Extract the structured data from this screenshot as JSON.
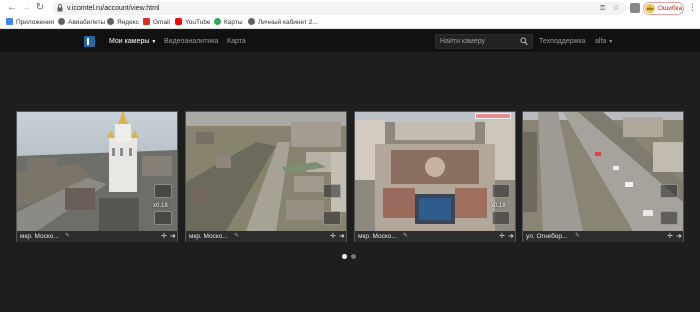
{
  "browser": {
    "url": "v.icomtel.ru/account/view.html",
    "profile_status": "Ошибка",
    "avatar_text": "alfa",
    "bookmarks": [
      {
        "label": "Приложения",
        "icon": "apps-grid-icon",
        "color": "#4285f4"
      },
      {
        "label": "Авиабилеты",
        "icon": "globe-icon",
        "color": "#5f6368"
      },
      {
        "label": "Яндекс",
        "icon": "globe-icon",
        "color": "#5f6368"
      },
      {
        "label": "Gmail",
        "icon": "gmail-icon",
        "color": "#d93025"
      },
      {
        "label": "YouTube",
        "icon": "youtube-icon",
        "color": "#ff0000"
      },
      {
        "label": "Карты",
        "icon": "maps-pin-icon",
        "color": "#34a853"
      },
      {
        "label": "Личный кабинет 2...",
        "icon": "globe-icon",
        "color": "#5f6368"
      }
    ]
  },
  "nav": {
    "my_cameras": "Мои камеры",
    "video_analytics": "Видеоаналитика",
    "map": "Карта",
    "search_placeholder": "Найти камеру",
    "support": "Техподдержка",
    "user": "alfa"
  },
  "cameras": [
    {
      "title": "мкр. Моско...",
      "zoom": "x0.18"
    },
    {
      "title": "мкр. Моско...",
      "zoom": ""
    },
    {
      "title": "мкр. Моско...",
      "zoom": "x0.18"
    },
    {
      "title": "ул. Огнебор...",
      "zoom": ""
    }
  ],
  "pagination": {
    "pages": 2,
    "current": 1
  },
  "colors": {
    "nav_bg": "#111111",
    "page_bg": "#1e1e1e",
    "active_dot": "#ffffff",
    "inactive_dot": "#777777",
    "error": "#c5221f"
  }
}
